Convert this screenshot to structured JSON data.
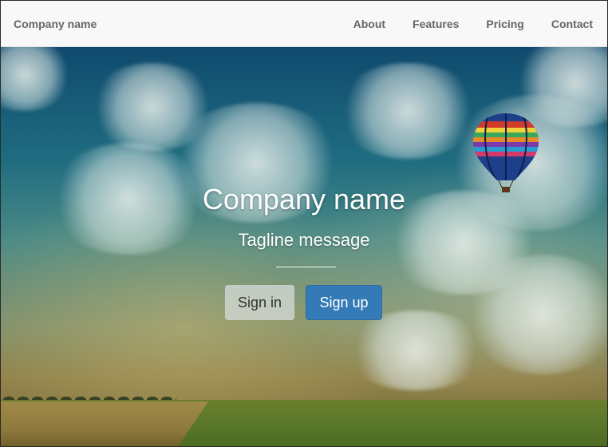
{
  "navbar": {
    "brand": "Company name",
    "links": [
      "About",
      "Features",
      "Pricing",
      "Contact"
    ]
  },
  "hero": {
    "title": "Company name",
    "tagline": "Tagline message",
    "buttons": {
      "signin_label": "Sign in",
      "signup_label": "Sign up"
    }
  },
  "colors": {
    "navbar_bg": "#f8f8f8",
    "nav_text": "#666666",
    "primary_button": "#337ab7",
    "secondary_button": "rgba(220,225,225,0.7)"
  },
  "icons": {
    "background_image": "hot-air-balloon-landscape"
  }
}
